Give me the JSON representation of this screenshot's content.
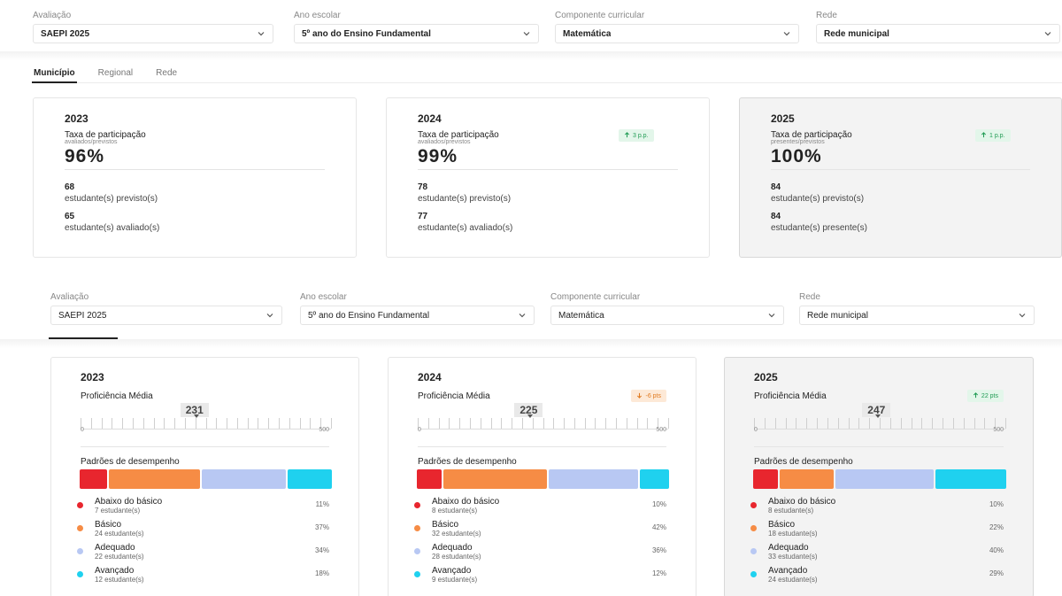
{
  "filters_top": [
    {
      "label": "Avaliação",
      "value": "SAEPI 2025"
    },
    {
      "label": "Ano escolar",
      "value": "5º ano do Ensino Fundamental"
    },
    {
      "label": "Componente curricular",
      "value": "Matemática"
    },
    {
      "label": "Rede",
      "value": "Rede municipal"
    }
  ],
  "tabs": [
    {
      "label": "Município",
      "active": true
    },
    {
      "label": "Regional",
      "active": false
    },
    {
      "label": "Rede",
      "active": false
    }
  ],
  "participation_cards": [
    {
      "year": "2023",
      "title": "Taxa de participação",
      "subtitle": "avaliados/previstos",
      "value": "96%",
      "badge": null,
      "count1": "68",
      "count1_label": "estudante(s) previsto(s)",
      "count2": "65",
      "count2_label": "estudante(s) avaliado(s)"
    },
    {
      "year": "2024",
      "title": "Taxa de participação",
      "subtitle": "avaliados/previstos",
      "value": "99%",
      "badge": "3 p.p.",
      "count1": "78",
      "count1_label": "estudante(s) previsto(s)",
      "count2": "77",
      "count2_label": "estudante(s) avaliado(s)"
    },
    {
      "year": "2025",
      "title": "Taxa de participação",
      "subtitle": "presentes/previstos",
      "value": "100%",
      "badge": "1 p.p.",
      "count1": "84",
      "count1_label": "estudante(s) previsto(s)",
      "count2": "84",
      "count2_label": "estudante(s) presente(s)"
    }
  ],
  "filters_bottom": [
    {
      "label": "Avaliação",
      "value": "SAEPI 2025"
    },
    {
      "label": "Ano escolar",
      "value": "5º ano do Ensino Fundamental"
    },
    {
      "label": "Componente curricular",
      "value": "Matemática"
    },
    {
      "label": "Rede",
      "value": "Rede municipal"
    }
  ],
  "proficiency_cards": [
    {
      "year": "2023",
      "title": "Proficiência Média",
      "value": "231",
      "proficiency": 231,
      "badge": null,
      "badge_dir": null,
      "scale_min": "0",
      "scale_max": "500",
      "levels_title": "Padrões de desempenho",
      "levels": [
        {
          "name": "Abaixo do básico",
          "count": "7 estudante(s)",
          "pct": "11%",
          "share": 11
        },
        {
          "name": "Básico",
          "count": "24 estudante(s)",
          "pct": "37%",
          "share": 37
        },
        {
          "name": "Adequado",
          "count": "22 estudante(s)",
          "pct": "34%",
          "share": 34
        },
        {
          "name": "Avançado",
          "count": "12 estudante(s)",
          "pct": "18%",
          "share": 18
        }
      ]
    },
    {
      "year": "2024",
      "title": "Proficiência Média",
      "value": "225",
      "proficiency": 225,
      "badge": "-6 pts",
      "badge_dir": "down",
      "scale_min": "0",
      "scale_max": "500",
      "levels_title": "Padrões de desempenho",
      "levels": [
        {
          "name": "Abaixo do básico",
          "count": "8 estudante(s)",
          "pct": "10%",
          "share": 10
        },
        {
          "name": "Básico",
          "count": "32 estudante(s)",
          "pct": "42%",
          "share": 42
        },
        {
          "name": "Adequado",
          "count": "28 estudante(s)",
          "pct": "36%",
          "share": 36
        },
        {
          "name": "Avançado",
          "count": "9 estudante(s)",
          "pct": "12%",
          "share": 12
        }
      ]
    },
    {
      "year": "2025",
      "title": "Proficiência Média",
      "value": "247",
      "proficiency": 247,
      "badge": "22 pts",
      "badge_dir": "up",
      "scale_min": "0",
      "scale_max": "500",
      "levels_title": "Padrões de desempenho",
      "levels": [
        {
          "name": "Abaixo do básico",
          "count": "8 estudante(s)",
          "pct": "10%",
          "share": 10
        },
        {
          "name": "Básico",
          "count": "18 estudante(s)",
          "pct": "22%",
          "share": 22
        },
        {
          "name": "Adequado",
          "count": "33 estudante(s)",
          "pct": "40%",
          "share": 40
        },
        {
          "name": "Avançado",
          "count": "24 estudante(s)",
          "pct": "29%",
          "share": 29
        }
      ]
    }
  ],
  "colors": {
    "abaixo": "#e8262e",
    "basico": "#f68c45",
    "adequado": "#b8c8f3",
    "avancado": "#1fd1ef",
    "up_text": "#1f9b53",
    "down_text": "#e07a1f"
  },
  "icons": {
    "select": "chevron-down-icon",
    "up": "arrow-up-icon",
    "down": "arrow-down-icon"
  }
}
